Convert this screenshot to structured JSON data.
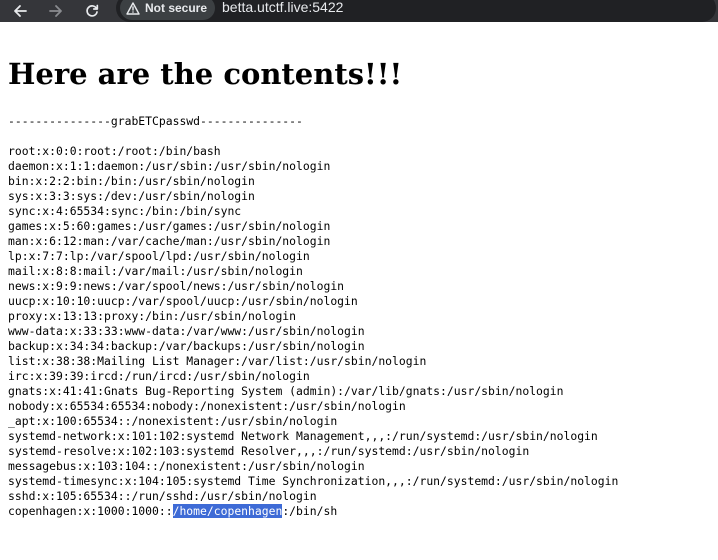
{
  "browser": {
    "security_label": "Not secure",
    "url": "betta.utctf.live:5422"
  },
  "page": {
    "heading": "Here are the contents!!!",
    "separator": "---------------grabETCpasswd---------------",
    "lines": [
      "root:x:0:0:root:/root:/bin/bash",
      "daemon:x:1:1:daemon:/usr/sbin:/usr/sbin/nologin",
      "bin:x:2:2:bin:/bin:/usr/sbin/nologin",
      "sys:x:3:3:sys:/dev:/usr/sbin/nologin",
      "sync:x:4:65534:sync:/bin:/bin/sync",
      "games:x:5:60:games:/usr/games:/usr/sbin/nologin",
      "man:x:6:12:man:/var/cache/man:/usr/sbin/nologin",
      "lp:x:7:7:lp:/var/spool/lpd:/usr/sbin/nologin",
      "mail:x:8:8:mail:/var/mail:/usr/sbin/nologin",
      "news:x:9:9:news:/var/spool/news:/usr/sbin/nologin",
      "uucp:x:10:10:uucp:/var/spool/uucp:/usr/sbin/nologin",
      "proxy:x:13:13:proxy:/bin:/usr/sbin/nologin",
      "www-data:x:33:33:www-data:/var/www:/usr/sbin/nologin",
      "backup:x:34:34:backup:/var/backups:/usr/sbin/nologin",
      "list:x:38:38:Mailing List Manager:/var/list:/usr/sbin/nologin",
      "irc:x:39:39:ircd:/run/ircd:/usr/sbin/nologin",
      "gnats:x:41:41:Gnats Bug-Reporting System (admin):/var/lib/gnats:/usr/sbin/nologin",
      "nobody:x:65534:65534:nobody:/nonexistent:/usr/sbin/nologin",
      "_apt:x:100:65534::/nonexistent:/usr/sbin/nologin",
      "systemd-network:x:101:102:systemd Network Management,,,:/run/systemd:/usr/sbin/nologin",
      "systemd-resolve:x:102:103:systemd Resolver,,,:/run/systemd:/usr/sbin/nologin",
      "messagebus:x:103:104::/nonexistent:/usr/sbin/nologin",
      "systemd-timesync:x:104:105:systemd Time Synchronization,,,:/run/systemd:/usr/sbin/nologin",
      "sshd:x:105:65534::/run/sshd:/usr/sbin/nologin"
    ],
    "last_line": {
      "before": "copenhagen:x:1000:1000::",
      "selected": "/home/copenhagen",
      "after": ":/bin/sh"
    }
  }
}
